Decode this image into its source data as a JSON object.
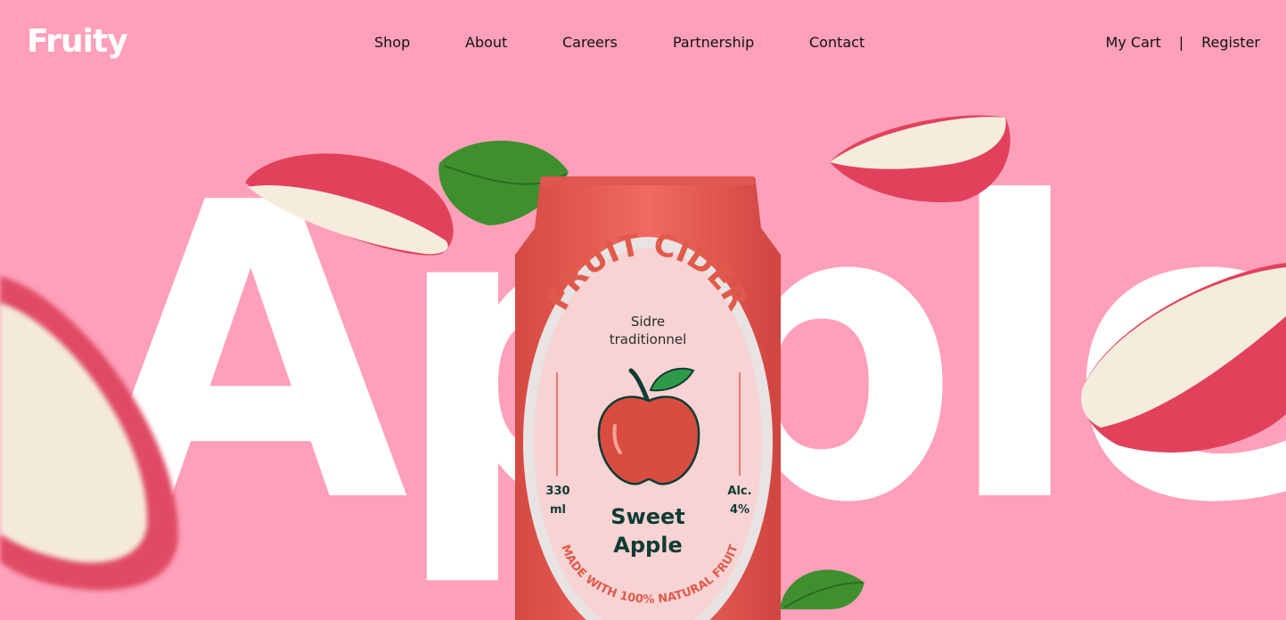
{
  "brand": {
    "name": "Fruity"
  },
  "nav": {
    "items": [
      {
        "label": "Shop"
      },
      {
        "label": "About"
      },
      {
        "label": "Careers"
      },
      {
        "label": "Partnership"
      },
      {
        "label": "Contact"
      }
    ]
  },
  "account": {
    "cart_label": "My Cart",
    "separator": "|",
    "register_label": "Register"
  },
  "hero": {
    "word": "Apple"
  },
  "product": {
    "arc_title": "FRUIT CIDER",
    "subtitle_line1": "Sidre",
    "subtitle_line2": "traditionnel",
    "volume_value": "330",
    "volume_unit": "ml",
    "alcohol_label": "Alc.",
    "alcohol_value": "4%",
    "name_line1": "Sweet",
    "name_line2": "Apple",
    "arc_footer": "MADE WITH 100% NATURAL FRUIT"
  },
  "colors": {
    "background": "#fea0ba",
    "can": "#e8574f",
    "label": "#f7d3d3",
    "accent_text": "#e05a4c",
    "dark_text": "#0f3b33"
  }
}
